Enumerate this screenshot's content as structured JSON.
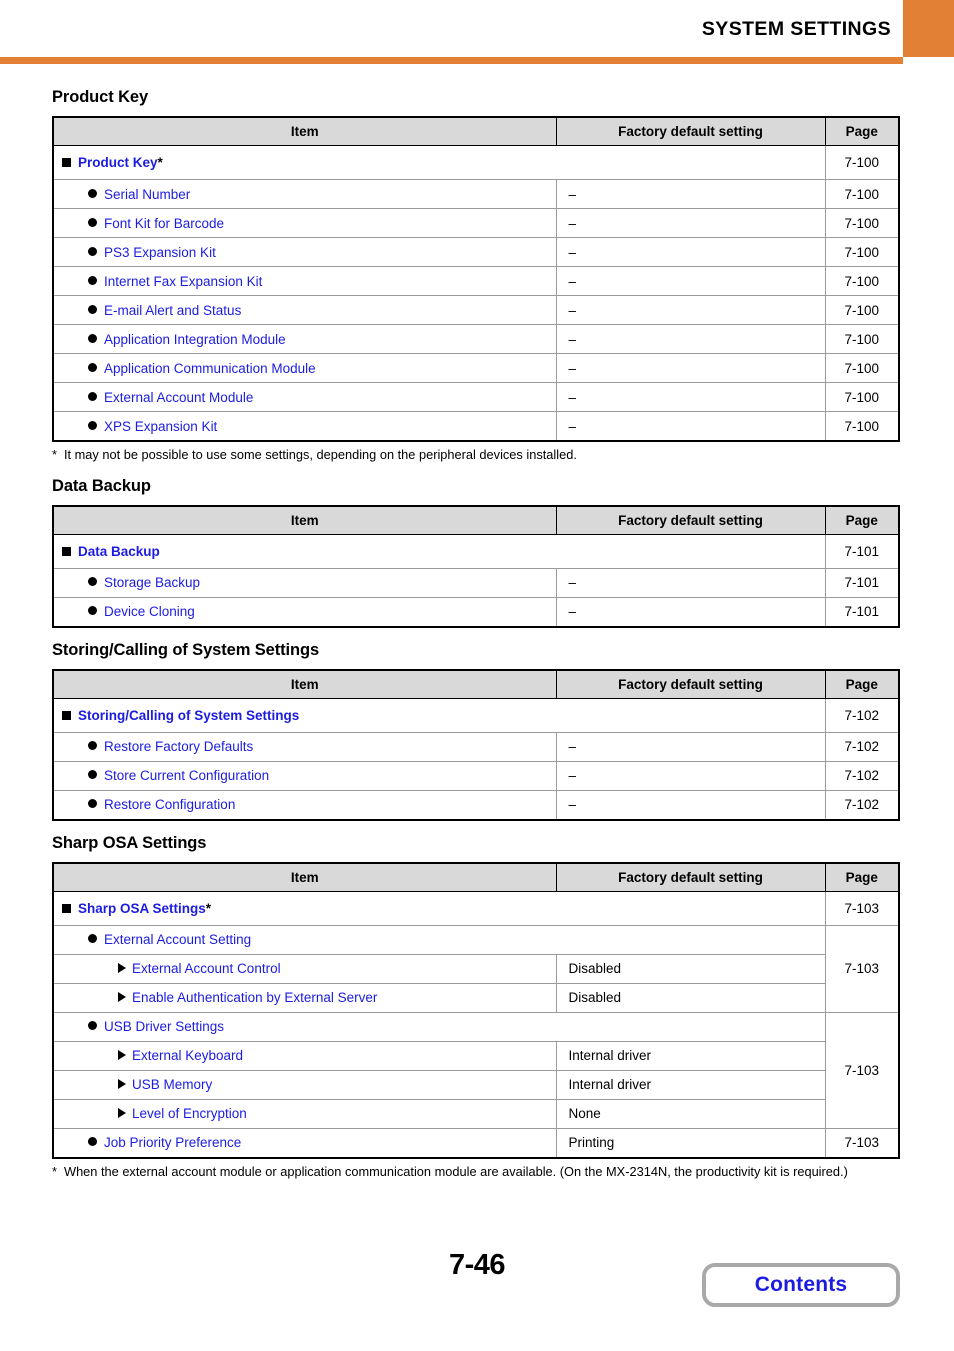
{
  "header": {
    "title": "SYSTEM SETTINGS",
    "accent_color": "#e28135"
  },
  "colors": {
    "link_blue": "#1c1ce0",
    "header_fill": "#d9d9d9",
    "accent_orange": "#e28135"
  },
  "table_headers": {
    "item": "Item",
    "value": "Factory default setting",
    "page": "Page"
  },
  "sections": [
    {
      "title": "Product Key",
      "rows": [
        {
          "level": 1,
          "label": "Product Key",
          "asterisk": "*",
          "value": "",
          "page": "7-100"
        },
        {
          "level": 2,
          "label": "Serial Number",
          "value": "–",
          "page": "7-100"
        },
        {
          "level": 2,
          "label": "Font Kit for Barcode",
          "value": "–",
          "page": "7-100"
        },
        {
          "level": 2,
          "label": "PS3 Expansion Kit",
          "value": "–",
          "page": "7-100"
        },
        {
          "level": 2,
          "label": "Internet Fax Expansion Kit",
          "value": "–",
          "page": "7-100"
        },
        {
          "level": 2,
          "label": "E-mail Alert and Status",
          "value": "–",
          "page": "7-100"
        },
        {
          "level": 2,
          "label": "Application Integration Module",
          "value": "–",
          "page": "7-100"
        },
        {
          "level": 2,
          "label": "Application Communication Module",
          "value": "–",
          "page": "7-100"
        },
        {
          "level": 2,
          "label": "External Account Module",
          "value": "–",
          "page": "7-100"
        },
        {
          "level": 2,
          "label": "XPS Expansion Kit",
          "value": "–",
          "page": "7-100"
        }
      ],
      "footnote": {
        "marker": "*",
        "text": "It may not be possible to use some settings, depending on the peripheral devices installed."
      }
    },
    {
      "title": "Data Backup",
      "rows": [
        {
          "level": 1,
          "label": "Data Backup",
          "asterisk": "",
          "value": "",
          "page": "7-101"
        },
        {
          "level": 2,
          "label": "Storage Backup",
          "value": "–",
          "page": "7-101"
        },
        {
          "level": 2,
          "label": "Device Cloning",
          "value": "–",
          "page": "7-101"
        }
      ],
      "footnote": null
    },
    {
      "title": "Storing/Calling of System Settings",
      "rows": [
        {
          "level": 1,
          "label": "Storing/Calling of System Settings",
          "asterisk": "",
          "value": "",
          "page": "7-102"
        },
        {
          "level": 2,
          "label": "Restore Factory Defaults",
          "value": "–",
          "page": "7-102"
        },
        {
          "level": 2,
          "label": "Store Current Configuration",
          "value": "–",
          "page": "7-102"
        },
        {
          "level": 2,
          "label": "Restore Configuration",
          "value": "–",
          "page": "7-102"
        }
      ],
      "footnote": null
    },
    {
      "title": "Sharp OSA Settings",
      "rows": [
        {
          "level": 1,
          "label": "Sharp OSA Settings",
          "asterisk": "*",
          "value": "",
          "page": "7-103"
        },
        {
          "level": 2,
          "label": "External Account Setting",
          "value": "",
          "page": "7-103",
          "group": true,
          "group_span": 3
        },
        {
          "level": 3,
          "label": "External Account Control",
          "value": "Disabled"
        },
        {
          "level": 3,
          "label": "Enable Authentication by External Server",
          "value": "Disabled"
        },
        {
          "level": 2,
          "label": "USB Driver Settings",
          "value": "",
          "page": "7-103",
          "group": true,
          "group_span": 4
        },
        {
          "level": 3,
          "label": "External Keyboard",
          "value": "Internal driver"
        },
        {
          "level": 3,
          "label": "USB Memory",
          "value": "Internal driver"
        },
        {
          "level": 3,
          "label": "Level of Encryption",
          "value": "None"
        },
        {
          "level": 2,
          "label": "Job Priority Preference",
          "value": "Printing",
          "page": "7-103"
        }
      ],
      "footnote": {
        "marker": "*",
        "text": "When the external account module or application communication module are available. (On the MX-2314N, the productivity kit is required.)"
      }
    }
  ],
  "footer": {
    "page_number": "7-46",
    "contents_label": "Contents"
  }
}
